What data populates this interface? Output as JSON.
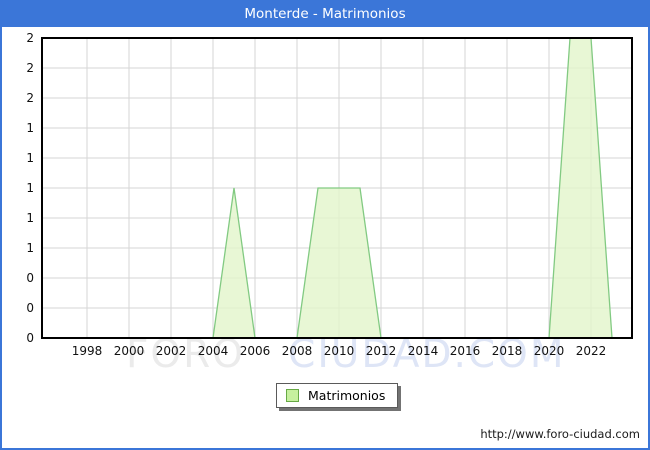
{
  "window": {
    "title": "Monterde - Matrimonios"
  },
  "colors": {
    "frame": "#3b76d8",
    "titlebar_bg": "#3b76d8",
    "titlebar_text": "#ffffff",
    "grid": "#d6d6d6",
    "axis_border": "#000000",
    "area_fill": "#e2f5cb",
    "area_stroke": "#82ca82",
    "legend_swatch_fill": "#c6f09e",
    "legend_swatch_border": "#67a945",
    "watermark_gray": "#ebebeb",
    "watermark_blue": "#dee5f6"
  },
  "chart_data": {
    "type": "area",
    "title": "Monterde - Matrimonios",
    "series": [
      {
        "name": "Matrimonios",
        "x": [
          1996,
          1997,
          1998,
          1999,
          2000,
          2001,
          2002,
          2003,
          2004,
          2005,
          2006,
          2007,
          2008,
          2009,
          2010,
          2011,
          2012,
          2013,
          2014,
          2015,
          2016,
          2017,
          2018,
          2019,
          2020,
          2021,
          2022,
          2023
        ],
        "values": [
          0,
          0,
          0,
          0,
          0,
          0,
          0,
          0,
          0,
          1,
          0,
          0,
          0,
          1,
          1,
          1,
          0,
          0,
          0,
          0,
          0,
          0,
          0,
          0,
          0,
          2,
          2,
          0
        ]
      }
    ],
    "xlabel": "",
    "ylabel": "",
    "ylim": [
      0,
      2
    ],
    "x_ticks": [
      1998,
      2000,
      2002,
      2004,
      2006,
      2008,
      2010,
      2012,
      2014,
      2016,
      2018,
      2020,
      2022
    ],
    "y_tick_values": [
      0,
      0.2,
      0.4,
      0.6,
      0.8,
      1,
      1.2,
      1.4,
      1.6,
      1.8,
      2
    ],
    "y_tick_labels": [
      "0",
      "0",
      "0",
      "1",
      "1",
      "1",
      "1",
      "1",
      "2",
      "2",
      "2"
    ],
    "grid": true,
    "legend_position": "bottom-center"
  },
  "legend": {
    "label": "Matrimonios"
  },
  "watermark": {
    "part1": "FORO",
    "part2": "CIUDAD.COM"
  },
  "footer": {
    "url": "http://www.foro-ciudad.com"
  }
}
